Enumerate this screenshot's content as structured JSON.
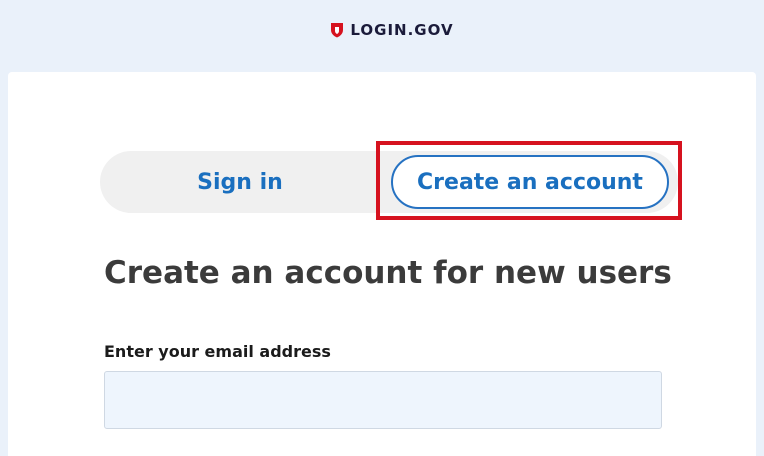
{
  "header": {
    "brand_text": "LOGIN.GOV",
    "brand_icon": "shield-icon",
    "brand_color": "#d6121f"
  },
  "tabs": {
    "sign_in_label": "Sign in",
    "create_account_label": "Create an account",
    "selected": "create_account"
  },
  "main": {
    "title": "Create an account for new users",
    "email_label": "Enter your email address",
    "email_value": ""
  },
  "colors": {
    "accent": "#1a6fbf",
    "highlight": "#d6121f",
    "page_background": "#eaf1fa",
    "input_background": "#eef5fd"
  }
}
